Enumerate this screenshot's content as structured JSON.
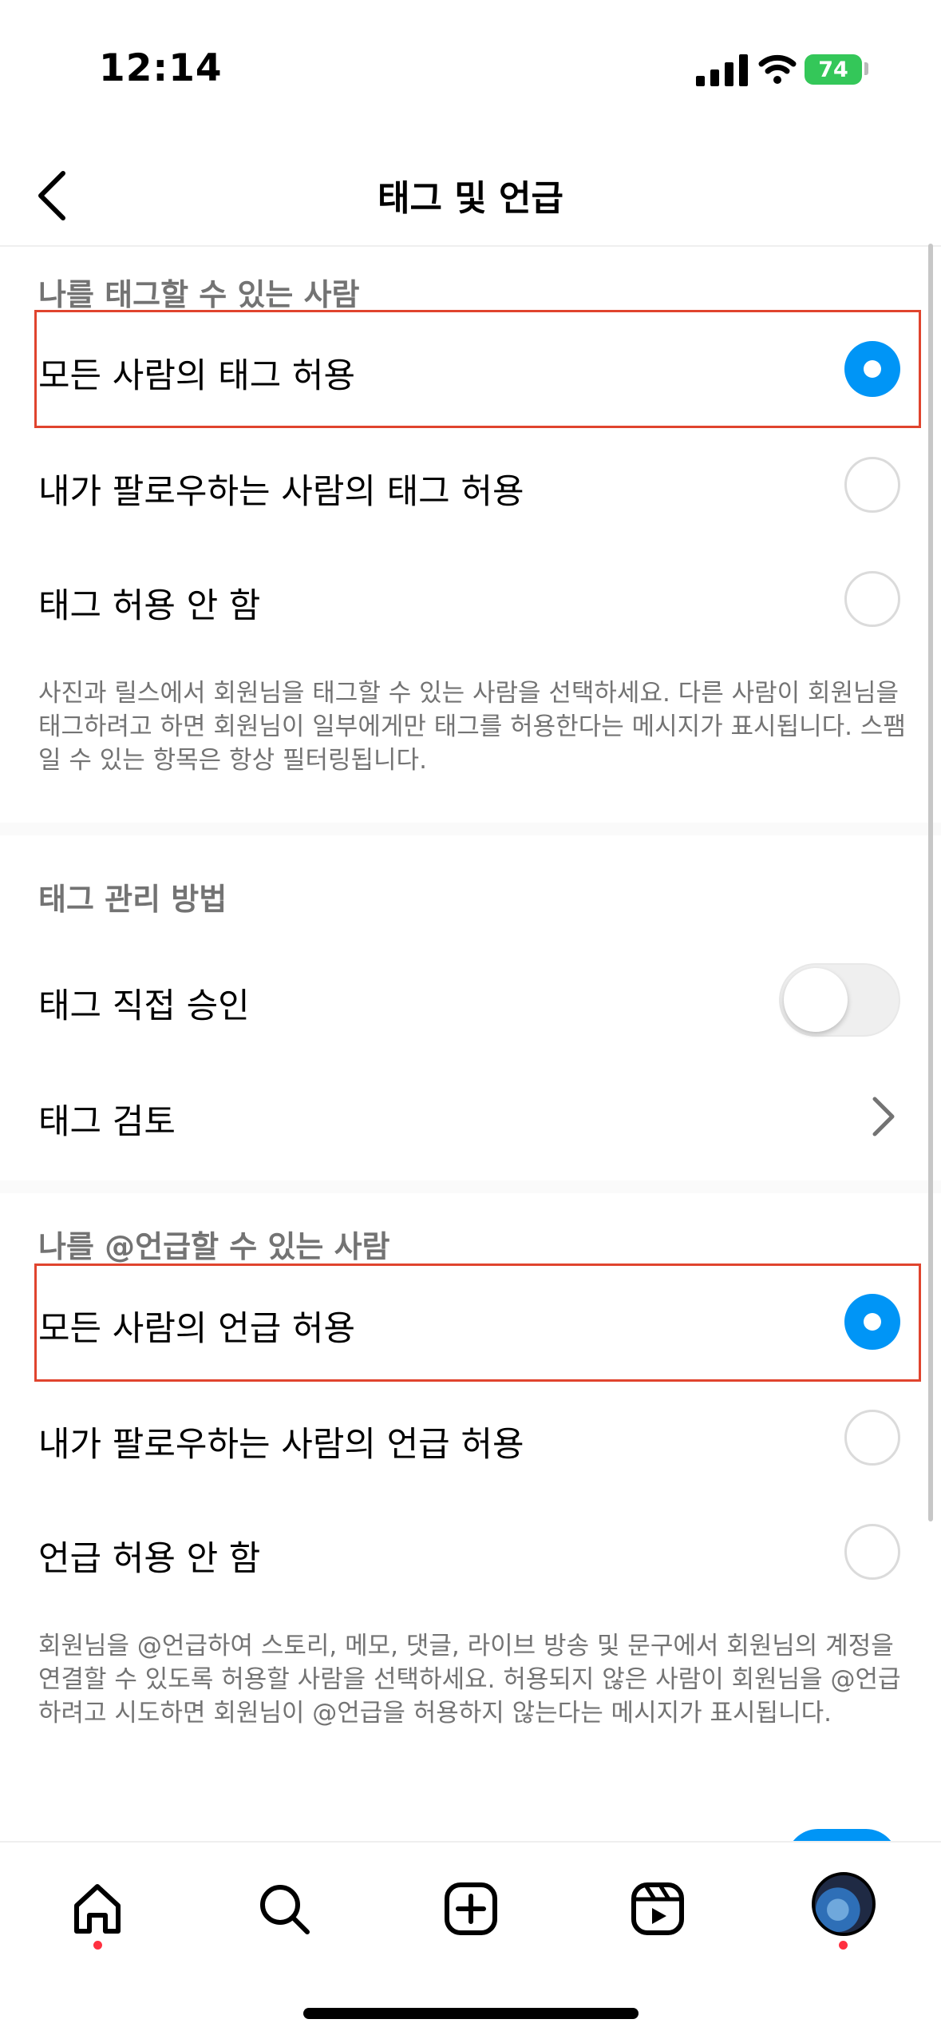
{
  "status_bar": {
    "time": "12:14",
    "battery": "74"
  },
  "header": {
    "title": "태그 및 언급"
  },
  "tags": {
    "section_title": "나를 태그할 수 있는 사람",
    "options": [
      {
        "label": "모든 사람의 태그 허용",
        "selected": true
      },
      {
        "label": "내가 팔로우하는 사람의 태그 허용",
        "selected": false
      },
      {
        "label": "태그 허용 안 함",
        "selected": false
      }
    ],
    "description": "사진과 릴스에서 회원님을 태그할 수 있는 사람을 선택하세요. 다른 사람이 회원님을 태그하려고 하면 회원님이 일부에게만 태그를 허용한다는 메시지가 표시됩니다. 스팸일 수 있는 항목은 항상 필터링됩니다."
  },
  "tag_management": {
    "section_title": "태그 관리 방법",
    "manual_approve": {
      "label": "태그 직접 승인",
      "on": false
    },
    "review": {
      "label": "태그 검토"
    }
  },
  "mentions": {
    "section_title": "나를 @언급할 수 있는 사람",
    "options": [
      {
        "label": "모든 사람의 언급 허용",
        "selected": true
      },
      {
        "label": "내가 팔로우하는 사람의 언급 허용",
        "selected": false
      },
      {
        "label": "언급 허용 안 함",
        "selected": false
      }
    ],
    "description": "회원님을 @언급하여 스토리, 메모, 댓글, 라이브 방송 및 문구에서 회원님의 계정을 연결할 수 있도록 허용할 사람을 선택하세요. 허용되지 않은 사람이 회원님을 @언급하려고 시도하면 회원님이 @언급을 허용하지 않는다는 메시지가 표시됩니다."
  },
  "tab_bar": {
    "items": [
      "home-icon",
      "search-icon",
      "create-icon",
      "reels-icon",
      "profile-avatar"
    ]
  },
  "colors": {
    "accent": "#0095f6",
    "highlight": "#e0442e",
    "notification_dot": "#ff3040"
  }
}
